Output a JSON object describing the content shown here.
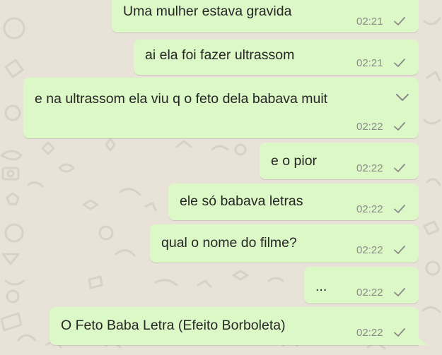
{
  "theme": {
    "bubble_color": "#dcf8c6",
    "wallpaper_color": "#e8e2d9",
    "doodle_color": "#d8d1c6",
    "text_color": "#262626",
    "meta_color": "#8a8a8a"
  },
  "messages": [
    {
      "text": "Uma mulher estava gravida",
      "time": "02:21",
      "status_icon": "check-icon"
    },
    {
      "text": "ai ela foi fazer ultrassom",
      "time": "02:21",
      "status_icon": "check-icon"
    },
    {
      "text": "e na ultrassom ela viu q o feto dela babava muit",
      "time": "02:22",
      "status_icon": "check-icon",
      "menu_icon": "chevron-down-icon"
    },
    {
      "text": "e o pior",
      "time": "02:22",
      "status_icon": "check-icon"
    },
    {
      "text": "ele só babava letras",
      "time": "02:22",
      "status_icon": "check-icon"
    },
    {
      "text": "qual o nome do filme?",
      "time": "02:22",
      "status_icon": "check-icon"
    },
    {
      "text": "...",
      "time": "02:22",
      "status_icon": "check-icon"
    },
    {
      "text": "O Feto Baba Letra (Efeito Borboleta)",
      "time": "02:22",
      "status_icon": "check-icon"
    }
  ]
}
